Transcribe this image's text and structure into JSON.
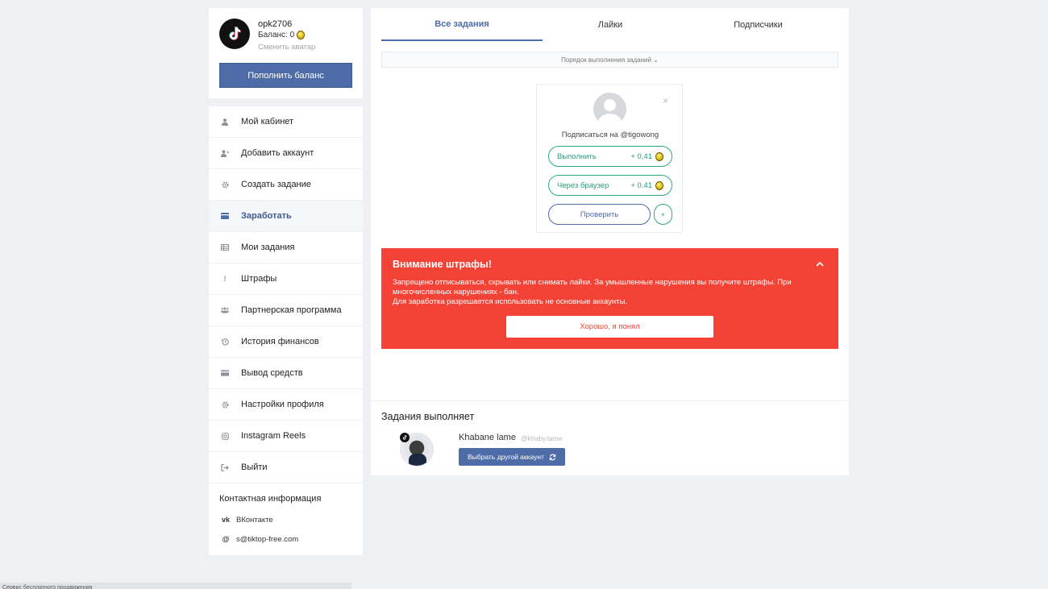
{
  "profile": {
    "username": "opk2706",
    "balance_label": "Баланс: 0",
    "change_avatar": "Сменить аватар",
    "topup_label": "Пополнить баланс"
  },
  "menu": {
    "items": [
      {
        "label": "Мой кабинет",
        "icon": "user-icon"
      },
      {
        "label": "Добавить аккаунт",
        "icon": "user-plus-icon"
      },
      {
        "label": "Создать задание",
        "icon": "gear-icon"
      },
      {
        "label": "Заработать",
        "icon": "card-icon",
        "active": true
      },
      {
        "label": "Мои задания",
        "icon": "table-icon"
      },
      {
        "label": "Штрафы",
        "icon": "exclamation-icon"
      },
      {
        "label": "Партнерская программа",
        "icon": "users-icon"
      },
      {
        "label": "История финансов",
        "icon": "history-icon"
      },
      {
        "label": "Вывод средств",
        "icon": "credit-card-icon"
      },
      {
        "label": "Настройки профиля",
        "icon": "settings-icon"
      },
      {
        "label": "Instagram Reels",
        "icon": "instagram-icon"
      },
      {
        "label": "Выйти",
        "icon": "logout-icon"
      }
    ],
    "contact_title": "Контактная информация",
    "contacts": [
      {
        "label": "ВКонтакте",
        "icon": "vk-icon"
      },
      {
        "label": "s@tiktop-free.com",
        "icon": "at-icon"
      }
    ]
  },
  "tabs": [
    "Все задания",
    "Лайки",
    "Подписчики"
  ],
  "order_label": "Порядок выполнения заданий ⌄",
  "task": {
    "title": "Подписаться на @tigowong",
    "do_label": "Выполнить",
    "do_reward": "+ 0,41",
    "browser_label": "Через браузер",
    "browser_reward": "+ 0.41",
    "check_label": "Проверить",
    "skip_label": "×",
    "close_label": "×"
  },
  "alert": {
    "title": "Внимание штрафы!",
    "line1": "Запрещено отписываться, скрывать или снимать лайки. За умышленные нарушения вы получите штрафы. При многочисленных нарушениях - бан.",
    "line2": "Для заработка разрешается использовать не основные аккаунты.",
    "button": "Хорошо, я понял"
  },
  "executor": {
    "title": "Задания выполняет",
    "name": "Khabane lame",
    "handle": "@khaby.lame",
    "switch_label": "Выбрать другой аккаунт"
  },
  "footer": {
    "text": "Сервис бесплатного продвижения"
  },
  "colors": {
    "primary": "#4d6ca8",
    "success": "#2eaa8a",
    "danger": "#f44336"
  }
}
